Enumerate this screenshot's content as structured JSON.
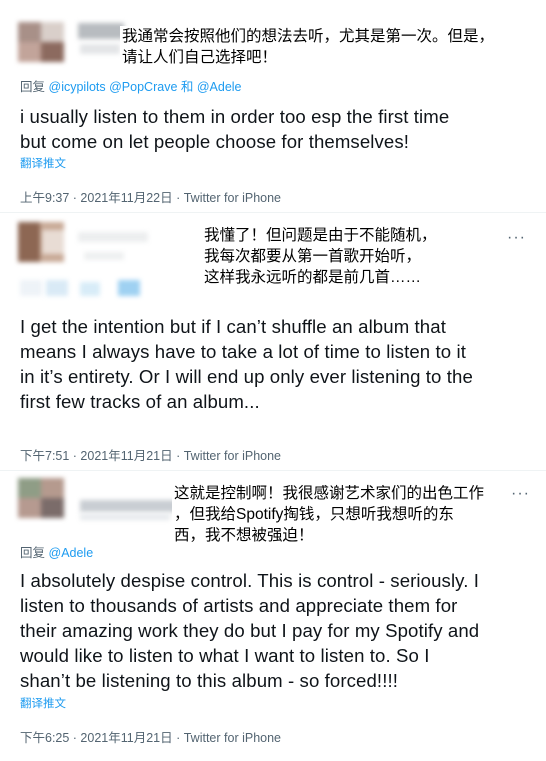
{
  "tweets": [
    {
      "translation": [
        "我通常会按照他们的想法去听，尤其是第一次。但是，",
        "请让人们自己选择吧！"
      ],
      "replying_label": "回复",
      "replying_handles": "@icypilots @PopCrave 和 @Adele",
      "text": [
        "i usually listen to them in order too esp the first time",
        "but come on let people choose for themselves!"
      ],
      "translate_label": "翻译推文",
      "timestamp": "上午9:37 · 2021年11月22日 · Twitter for iPhone"
    },
    {
      "translation": [
        "我懂了！但问题是由于不能随机，",
        "我每次都要从第一首歌开始听，",
        "这样我永远听的都是前几首……"
      ],
      "more": "···",
      "text": [
        "I get the intention but if I can’t shuffle an album that",
        "means I always have to take a lot of time to listen to it",
        "in it’s entirety. Or I will end up only ever listening to the",
        "first few tracks of an album..."
      ],
      "timestamp": "下午7:51 · 2021年11月21日 · Twitter for iPhone"
    },
    {
      "translation": [
        "这就是控制啊！我很感谢艺术家们的出色工作",
        "，但我给Spotify掏钱，只想听我想听的东",
        "西，我不想被强迫！"
      ],
      "more": "···",
      "replying_label": "回复",
      "replying_handles": "@Adele",
      "text": [
        "I absolutely despise control. This is control - seriously. I",
        "listen to thousands of artists and appreciate them for",
        "their amazing work they do but I pay for my Spotify and",
        "would like to listen to what I want to listen to. So I",
        "shan’t be listening to this album - so forced!!!!"
      ],
      "translate_label": "翻译推文",
      "timestamp": "下午6:25 · 2021年11月21日 · Twitter for iPhone"
    }
  ]
}
